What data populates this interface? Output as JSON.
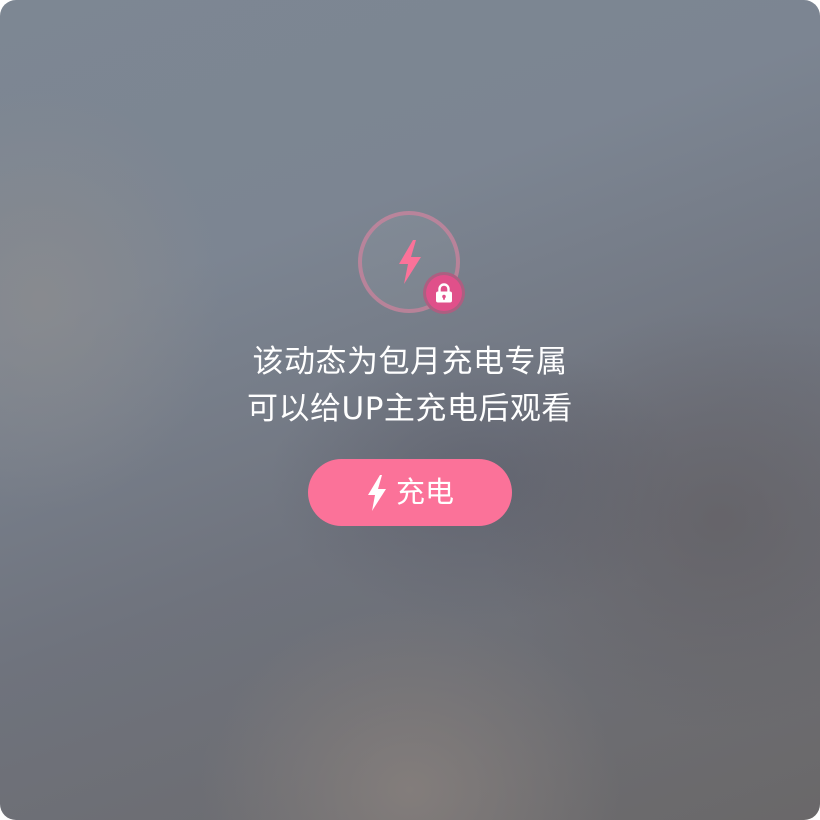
{
  "locked_post": {
    "message_line1": "该动态为包月充电专属",
    "message_line2": "可以给UP主充电后观看",
    "icons": {
      "main": "lightning-bolt-icon",
      "badge": "lock-icon",
      "button": "lightning-bolt-icon"
    },
    "charge_button": {
      "label": "充电"
    }
  },
  "colors": {
    "accent": "#fb7299",
    "badge": "#e0508a",
    "ring": "#e882a0",
    "text": "#ffffff"
  }
}
